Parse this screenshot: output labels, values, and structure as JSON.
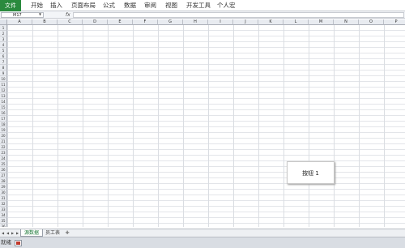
{
  "ribbon": {
    "file_tab": "文件",
    "tabs": [
      "开始",
      "插入",
      "页面布局",
      "公式",
      "数据",
      "审阅",
      "视图",
      "开发工具",
      "个人宏"
    ]
  },
  "formula_bar": {
    "name_box": "M17",
    "fx_label": "fx",
    "formula": ""
  },
  "grid": {
    "columns": [
      "A",
      "B",
      "C",
      "D",
      "E",
      "F",
      "G",
      "H",
      "I",
      "J",
      "K",
      "L",
      "M",
      "N",
      "O",
      "P"
    ],
    "rows": [
      "1",
      "2",
      "3",
      "4",
      "5",
      "6",
      "7",
      "8",
      "9",
      "10",
      "11",
      "12",
      "13",
      "14",
      "15",
      "16",
      "17",
      "18",
      "19",
      "20",
      "21",
      "22",
      "23",
      "24",
      "25",
      "26",
      "27",
      "28",
      "29",
      "30",
      "31",
      "32",
      "33",
      "34",
      "35",
      "36"
    ]
  },
  "form_button": {
    "label": "按钮 1"
  },
  "sheet_tabs": {
    "tabs": [
      "源数据",
      "员工表"
    ]
  },
  "status_bar": {
    "text": "就绪"
  },
  "colors": {
    "file_tab": "#2a8a3e",
    "active_sheet_text": "#1f7a3a",
    "header_bg": "#e8ebf0"
  }
}
